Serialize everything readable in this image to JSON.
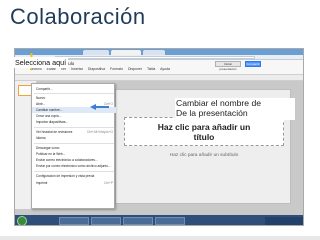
{
  "slide": {
    "title": "Colaboración"
  },
  "overlay": {
    "selecciona_label": "Selecciona aquí",
    "cambiar_label_line1": "Cambiar el nombre de",
    "cambiar_label_line2": "De la presentación"
  },
  "doc": {
    "title": "Presentación sin título",
    "menus": [
      "Archivo",
      "Editar",
      "Ver",
      "Insertar",
      "Diapositiva",
      "Formato",
      "Disponer",
      "Tabla",
      "Ayuda"
    ],
    "present_label": "Iniciar presentación",
    "share_label": "Compartir"
  },
  "file_menu": {
    "items": [
      {
        "label": "Compartir...",
        "shortcut": ""
      },
      {
        "label": "Nuevo",
        "shortcut": ""
      },
      {
        "label": "Abrir...",
        "shortcut": "Ctrl+O"
      },
      {
        "label": "Cambiar nombre...",
        "shortcut": ""
      },
      {
        "label": "Crear una copia...",
        "shortcut": ""
      },
      {
        "label": "Importar diapositivas...",
        "shortcut": ""
      },
      {
        "label": "Ver historial de revisiones",
        "shortcut": "Ctrl+Alt+Mayús+G"
      },
      {
        "label": "Idioma",
        "shortcut": ""
      },
      {
        "label": "Descargar como",
        "shortcut": ""
      },
      {
        "label": "Publicar en la Web...",
        "shortcut": ""
      },
      {
        "label": "Enviar correo electrónico a colaboradores...",
        "shortcut": ""
      },
      {
        "label": "Enviar por correo electrónico como archivo adjunto...",
        "shortcut": ""
      },
      {
        "label": "Configuración de impresión y vista previa",
        "shortcut": ""
      },
      {
        "label": "Imprimir",
        "shortcut": "Ctrl+P"
      }
    ]
  },
  "canvas": {
    "title_placeholder_line1": "Haz clic para añadir un",
    "title_placeholder_line2": "título",
    "subtitle_placeholder": "Haz clic para añadir un subtítulo"
  },
  "colors": {
    "title": "#1e3c5a",
    "callout_arrow": "#f2c200",
    "pointer_arrow": "#3a7fd1",
    "share_button": "#4d90fe"
  },
  "icons": [
    "yellow-arrow-icon",
    "blue-arrow-icon",
    "start-orb-icon"
  ]
}
